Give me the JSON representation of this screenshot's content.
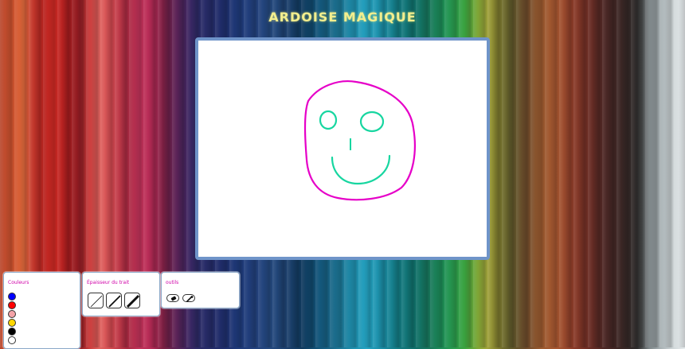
{
  "app": {
    "title": "ARDOISE MAGIQUE"
  },
  "colors_panel": {
    "label": "Couleurs",
    "swatches": [
      "#0000ff",
      "#ff0000",
      "#f4a3a8",
      "#ffd700",
      "#000000",
      "#ffffff"
    ]
  },
  "thickness_panel": {
    "label": "Épaisseur du trait",
    "options": [
      "thin",
      "medium",
      "thick"
    ]
  },
  "tools_panel": {
    "label": "outils",
    "tools": [
      "eraser-icon",
      "pipette-icon"
    ]
  },
  "drawing": {
    "face_color": "#e600c8",
    "features_color": "#17d6a0"
  }
}
